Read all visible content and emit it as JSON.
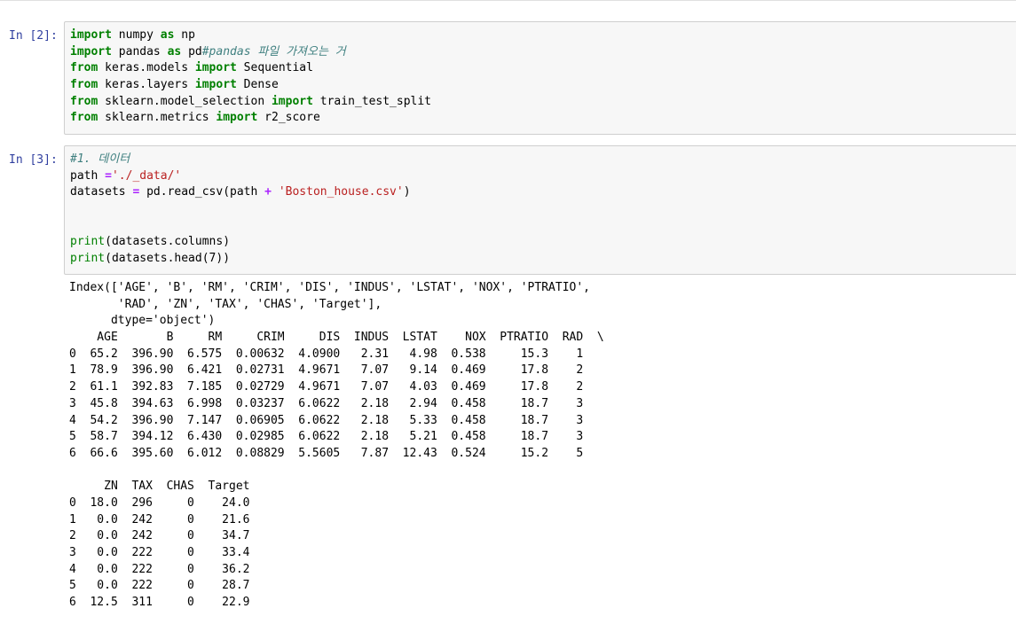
{
  "cells": [
    {
      "prompt": "In [2]:",
      "lines": [
        [
          {
            "t": "import",
            "c": "kw"
          },
          {
            "t": " numpy ",
            "c": ""
          },
          {
            "t": "as",
            "c": "kw"
          },
          {
            "t": " np",
            "c": ""
          }
        ],
        [
          {
            "t": "import",
            "c": "kw"
          },
          {
            "t": " pandas ",
            "c": ""
          },
          {
            "t": "as",
            "c": "kw"
          },
          {
            "t": " pd",
            "c": ""
          },
          {
            "t": "#pandas 파일 가져오는 거",
            "c": "cm"
          }
        ],
        [
          {
            "t": "from",
            "c": "kw"
          },
          {
            "t": " keras.models ",
            "c": ""
          },
          {
            "t": "import",
            "c": "kw"
          },
          {
            "t": " Sequential",
            "c": ""
          }
        ],
        [
          {
            "t": "from",
            "c": "kw"
          },
          {
            "t": " keras.layers ",
            "c": ""
          },
          {
            "t": "import",
            "c": "kw"
          },
          {
            "t": " Dense",
            "c": ""
          }
        ],
        [
          {
            "t": "from",
            "c": "kw"
          },
          {
            "t": " sklearn.model_selection ",
            "c": ""
          },
          {
            "t": "import",
            "c": "kw"
          },
          {
            "t": " train_test_split",
            "c": ""
          }
        ],
        [
          {
            "t": "from",
            "c": "kw"
          },
          {
            "t": " sklearn.metrics ",
            "c": ""
          },
          {
            "t": "import",
            "c": "kw"
          },
          {
            "t": " r2_score",
            "c": ""
          }
        ]
      ]
    },
    {
      "prompt": "In [3]:",
      "lines": [
        [
          {
            "t": "#1. 데이터",
            "c": "cm"
          }
        ],
        [
          {
            "t": "path ",
            "c": ""
          },
          {
            "t": "=",
            "c": "op"
          },
          {
            "t": "'./_data/'",
            "c": "st"
          }
        ],
        [
          {
            "t": "datasets ",
            "c": ""
          },
          {
            "t": "=",
            "c": "op"
          },
          {
            "t": " pd.read_csv(path ",
            "c": ""
          },
          {
            "t": "+",
            "c": "op"
          },
          {
            "t": " ",
            "c": ""
          },
          {
            "t": "'Boston_house.csv'",
            "c": "st"
          },
          {
            "t": ")",
            "c": ""
          }
        ],
        [],
        [],
        [
          {
            "t": "print",
            "c": "fn"
          },
          {
            "t": "(datasets.columns)",
            "c": ""
          }
        ],
        [
          {
            "t": "print",
            "c": "fn"
          },
          {
            "t": "(datasets.head(7))",
            "c": ""
          }
        ]
      ]
    }
  ],
  "output_lines": [
    "Index(['AGE', 'B', 'RM', 'CRIM', 'DIS', 'INDUS', 'LSTAT', 'NOX', 'PTRATIO',",
    "       'RAD', 'ZN', 'TAX', 'CHAS', 'Target'],",
    "      dtype='object')",
    "    AGE       B     RM     CRIM     DIS  INDUS  LSTAT    NOX  PTRATIO  RAD  \\",
    "0  65.2  396.90  6.575  0.00632  4.0900   2.31   4.98  0.538     15.3    1",
    "1  78.9  396.90  6.421  0.02731  4.9671   7.07   9.14  0.469     17.8    2",
    "2  61.1  392.83  7.185  0.02729  4.9671   7.07   4.03  0.469     17.8    2",
    "3  45.8  394.63  6.998  0.03237  6.0622   2.18   2.94  0.458     18.7    3",
    "4  54.2  396.90  7.147  0.06905  6.0622   2.18   5.33  0.458     18.7    3",
    "5  58.7  394.12  6.430  0.02985  6.0622   2.18   5.21  0.458     18.7    3",
    "6  66.6  395.60  6.012  0.08829  5.5605   7.87  12.43  0.524     15.2    5",
    "",
    "     ZN  TAX  CHAS  Target",
    "0  18.0  296     0    24.0",
    "1   0.0  242     0    21.6",
    "2   0.0  242     0    34.7",
    "3   0.0  222     0    33.4",
    "4   0.0  222     0    36.2",
    "5   0.0  222     0    28.7",
    "6  12.5  311     0    22.9"
  ]
}
